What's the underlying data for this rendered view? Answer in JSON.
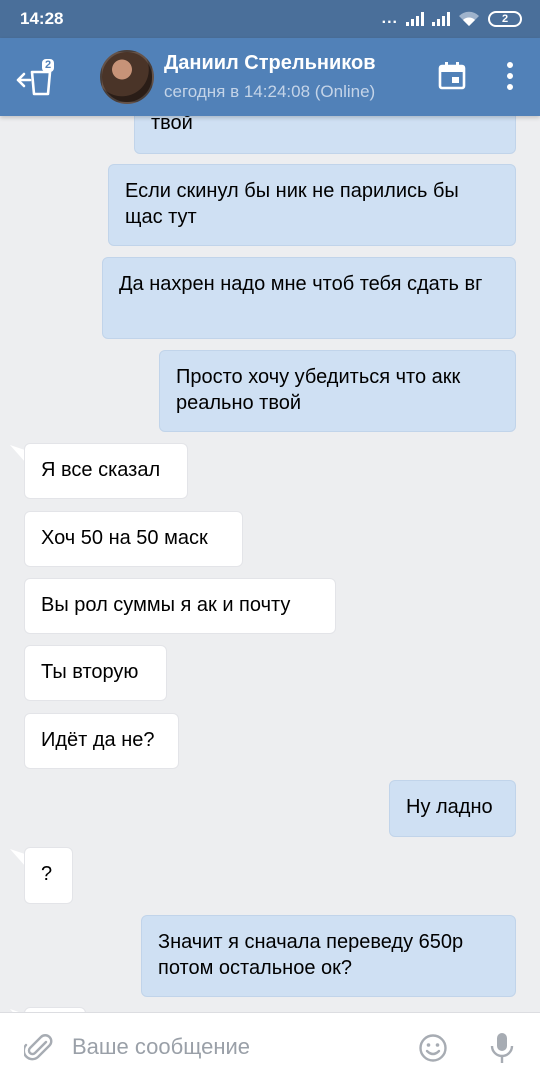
{
  "status_bar": {
    "time": "14:28",
    "dots": "...",
    "battery": "2"
  },
  "header": {
    "unread_count": "2",
    "contact_name": "Даниил Стрельников",
    "contact_status": "сегодня в 14:24:08 (Online)",
    "icons": [
      "back-arrow-icon",
      "calendar-icon",
      "more-vertical-icon"
    ]
  },
  "messages": [
    {
      "direction": "out",
      "text": "твой"
    },
    {
      "direction": "out",
      "text": "Если скинул бы ник не парились бы щас тут"
    },
    {
      "direction": "out",
      "text": "Да нахрен надо мне чтоб тебя сдать вг"
    },
    {
      "direction": "out",
      "text": "Просто хочу убедиться что акк реально твой"
    },
    {
      "direction": "in",
      "text": "Я все сказал"
    },
    {
      "direction": "in",
      "text": "Хоч 50 на 50 маск"
    },
    {
      "direction": "in",
      "text": "Вы рол суммы я ак и почту"
    },
    {
      "direction": "in",
      "text": "Ты вторую"
    },
    {
      "direction": "in",
      "text": "Идёт да не?"
    },
    {
      "direction": "out",
      "text": "Ну ладно"
    },
    {
      "direction": "in",
      "text": "?"
    },
    {
      "direction": "out",
      "text": "Значит я сначала переведу 650р потом остальное ок?"
    }
  ],
  "composer": {
    "placeholder": "Ваше сообщение",
    "value": "",
    "icons": [
      "attach-icon",
      "emoji-icon",
      "microphone-icon"
    ]
  },
  "colors": {
    "status_bar": "#4a6f9a",
    "header": "#5181b8",
    "background": "#edeef0",
    "outgoing_bubble": "#cfe0f3",
    "incoming_bubble": "#ffffff"
  }
}
